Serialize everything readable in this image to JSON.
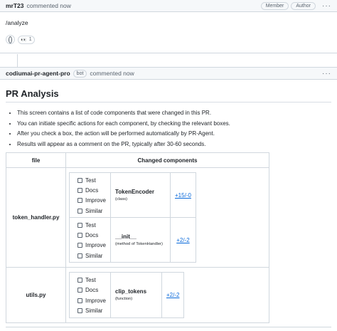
{
  "comment1": {
    "author": "mrT23",
    "meta": "commented now",
    "badges": [
      "Member",
      "Author"
    ],
    "body": "/analyze",
    "reactions": [
      {
        "icon": "eyes-emoji",
        "glyph": "👀",
        "count": "1"
      }
    ]
  },
  "comment2": {
    "author": "codiumai-pr-agent-pro",
    "bot_label": "bot",
    "meta": "commented now",
    "title": "PR Analysis",
    "bullets": [
      "This screen contains a list of code components that were changed in this PR.",
      "You can initiate specific actions for each component, by checking the relevant boxes.",
      "After you check a box, the action will be performed automatically by PR-Agent.",
      "Results will appear as a comment on the PR, typically after 30-60 seconds."
    ],
    "table": {
      "headers": [
        "file",
        "Changed components"
      ],
      "actions": [
        "Test",
        "Docs",
        "Improve",
        "Similar"
      ],
      "files": [
        {
          "name": "token_handler.py",
          "components": [
            {
              "name": "TokenEncoder",
              "kind": "(class)",
              "diff": "+15/-0"
            },
            {
              "name": "__init__",
              "kind": "(method of TokenHandler)",
              "diff": "+2/-2"
            }
          ]
        },
        {
          "name": "utils.py",
          "components": [
            {
              "name": "clip_tokens",
              "kind": "(function)",
              "diff": "+2/-2"
            }
          ]
        }
      ]
    }
  }
}
